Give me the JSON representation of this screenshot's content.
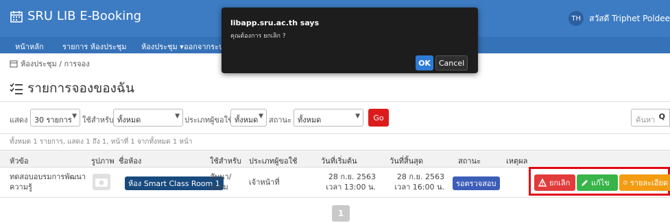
{
  "header": {
    "brand": "SRU LIB E-Booking",
    "avatar_initials": "TH",
    "greeting": "สวัสดี Triphet Poldee"
  },
  "nav": {
    "items": [
      "หน้าหลัก",
      "รายการ ห้องประชุม",
      "ห้องประชุม ▾",
      "ออกจากระบบ"
    ]
  },
  "breadcrumb": "ห้องประชุม / การจอง",
  "page_title": "รายการจองของฉัน",
  "filters": {
    "show_label": "แสดง",
    "show_value": "30 รายการ",
    "for_label": "ใช้สำหรับ",
    "for_value": "ทั้งหมด",
    "usertype_label": "ประเภทผู้ขอใช้",
    "usertype_value": "ทั้งหมด",
    "status_label": "สถานะ",
    "status_value": "ทั้งหมด",
    "go_label": "Go",
    "search_placeholder": "ค้นหา"
  },
  "summary": "ทั้งหมด 1 รายการ, แสดง 1 ถึง 1, หน้าที่ 1 จากทั้งหมด 1 หน้า",
  "table": {
    "headers": [
      "หัวข้อ",
      "รูปภาพ",
      "ชื่อห้อง",
      "ใช้สำหรับ",
      "ประเภทผู้ขอใช้",
      "วันที่เริ่มต้น",
      "วันที่สิ้นสุด",
      "สถานะ",
      "เหตุผล"
    ],
    "rows": [
      {
        "topic": "ทดสอบอบรมการพัฒนาความรู้",
        "room": "ห้อง Smart Class Room 1",
        "purpose": "สัมนา/อบรม",
        "user_type": "เจ้าหน้าที่",
        "start": "28 ก.ย. 2563 เวลา 13:00 น.",
        "end": "28 ก.ย. 2563 เวลา 16:00 น.",
        "status": "รอตรวจสอบ",
        "reason": ""
      }
    ]
  },
  "actions": {
    "cancel": "ยกเลิก",
    "edit": "แก้ไข",
    "details": "รายละเอียด"
  },
  "pagination": {
    "current": "1"
  },
  "dialog": {
    "title": "libapp.sru.ac.th says",
    "message": "คุณต้องการ ยกเลิก ?",
    "ok": "OK",
    "cancel": "Cancel"
  },
  "colors": {
    "navbar": "#3d7bc2",
    "go_button": "#dc1c1c",
    "cancel_button": "#e23b3b",
    "edit_button": "#38b449",
    "details_button": "#f39c12",
    "status_badge": "#3c5db8",
    "highlight_box": "#e30613"
  }
}
